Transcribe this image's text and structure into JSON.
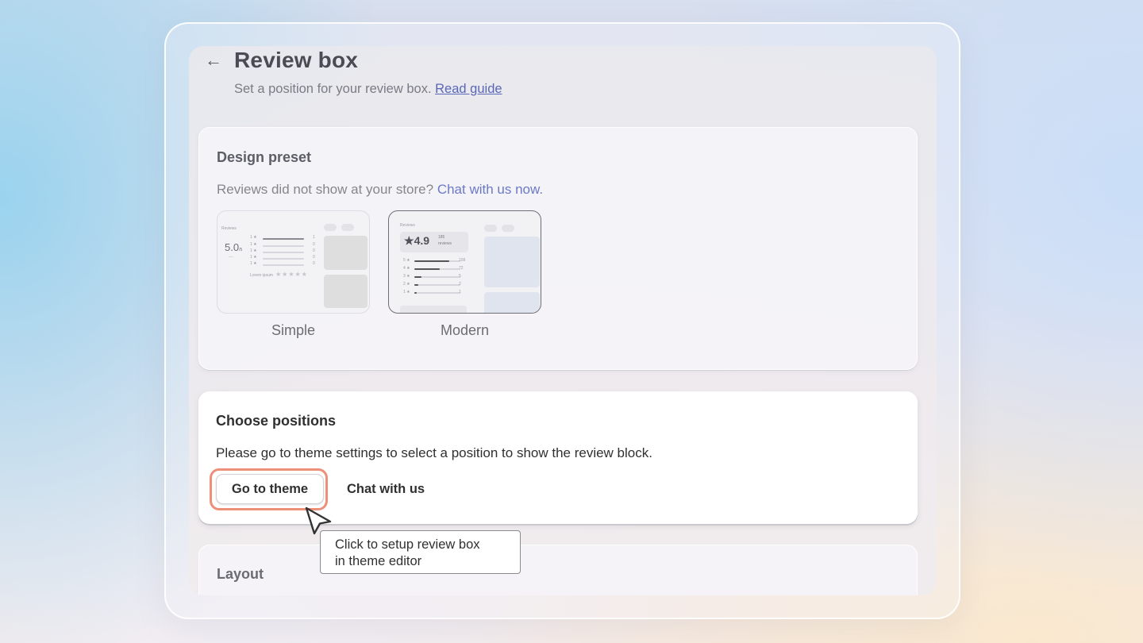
{
  "header": {
    "title": "Review box",
    "subtitle": "Set a position for your review box.",
    "guide_link": "Read guide"
  },
  "design_preset": {
    "title": "Design preset",
    "hint": "Reviews did not show at your store?",
    "hint_link": "Chat with us now.",
    "presets": [
      {
        "label": "Simple",
        "selected": false,
        "thumb_heading": "Reviews",
        "rating": "5.0",
        "rating_suffix": "/5"
      },
      {
        "label": "Modern",
        "selected": true,
        "thumb_heading": "Reviews",
        "rating": "4.9",
        "count": "185",
        "count_label": "reviews",
        "rows": [
          {
            "star": "5",
            "count": "109",
            "fill": 0.75
          },
          {
            "star": "4",
            "count": "72",
            "fill": 0.55
          },
          {
            "star": "3",
            "count": "5",
            "fill": 0.15
          },
          {
            "star": "2",
            "count": "2",
            "fill": 0.08
          },
          {
            "star": "1",
            "count": "1",
            "fill": 0.05
          }
        ]
      }
    ]
  },
  "choose_positions": {
    "title": "Choose positions",
    "description": "Please go to theme settings to select a position to show the review block.",
    "primary_button": "Go to theme",
    "secondary_button": "Chat with us"
  },
  "tooltip": {
    "line1": "Click to setup review box",
    "line2": "in theme editor"
  },
  "layout_section": {
    "title": "Layout"
  },
  "colors": {
    "accent_highlight": "#ee8f79",
    "link": "#5a67b8"
  }
}
